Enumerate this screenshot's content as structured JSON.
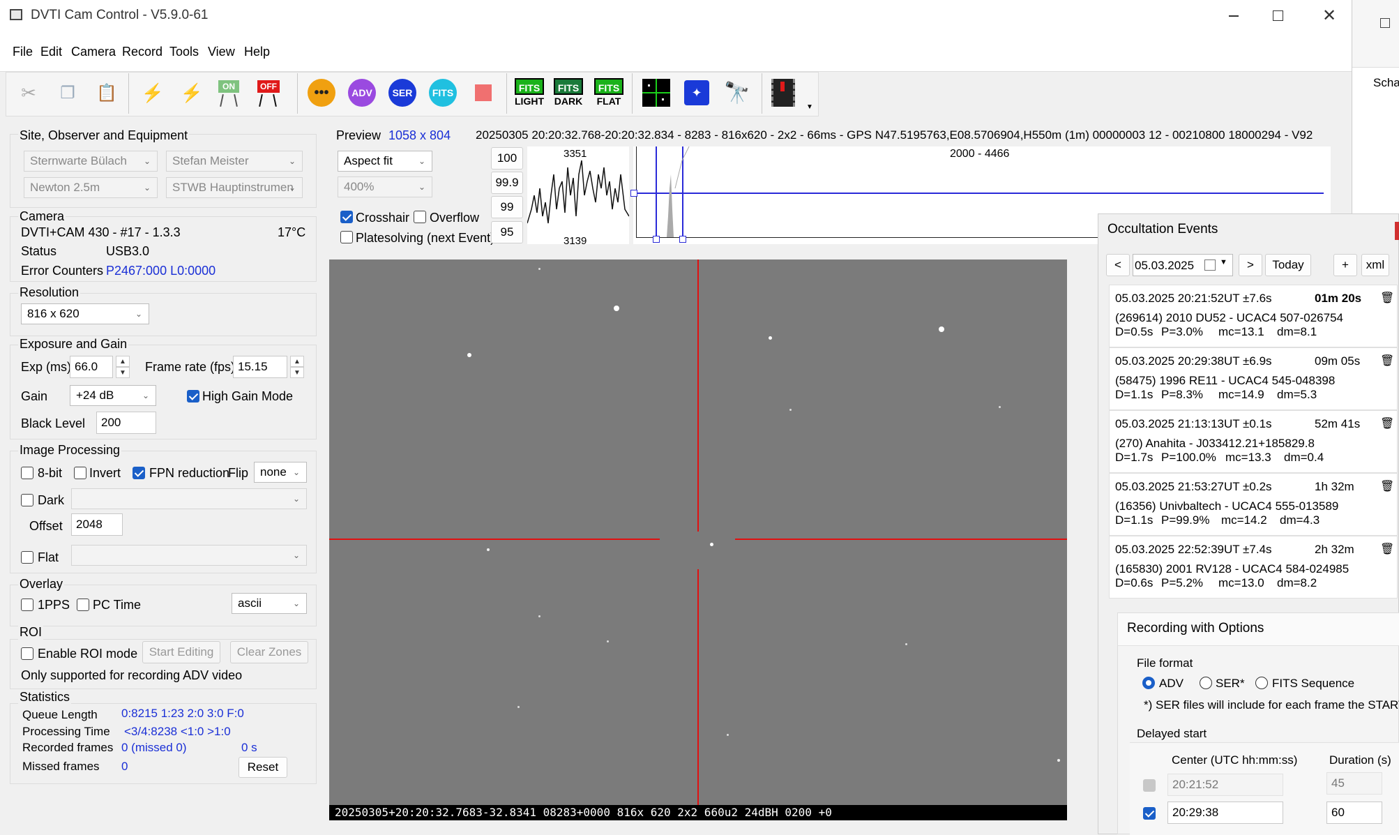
{
  "window": {
    "title": "DVTI Cam Control - V5.9.0-61"
  },
  "menu": [
    "File",
    "Edit",
    "Camera",
    "Record",
    "Tools",
    "View",
    "Help"
  ],
  "toolbar": {
    "adv": "ADV",
    "ser": "SER",
    "fits": "FITS",
    "fits_light": "LIGHT",
    "fits_dark": "DARK",
    "fits_flat": "FLAT",
    "on": "ON",
    "off": "OFF"
  },
  "site": {
    "title": "Site, Observer and Equipment",
    "site": "Sternwarte Bülach",
    "observer": "Stefan Meister",
    "telescope": "Newton 2.5m",
    "instrument": "STWB Hauptinstrumen"
  },
  "camera": {
    "title": "Camera",
    "model": "DVTI+CAM 430  -  #17  -  1.3.3",
    "temp": "17°C",
    "status_label": "Status",
    "status_value": "USB3.0",
    "errors_label": "Error Counters",
    "errors_value": "P2467:000 L0:0000"
  },
  "resolution": {
    "title": "Resolution",
    "value": "816 x 620"
  },
  "exposure": {
    "title": "Exposure and Gain",
    "exp_label": "Exp (ms)",
    "exp_value": "66.0",
    "fps_label": "Frame rate (fps)",
    "fps_value": "15.15",
    "gain_label": "Gain",
    "gain_value": "+24 dB",
    "high_gain_label": "High Gain Mode",
    "high_gain": true,
    "black_label": "Black Level",
    "black_value": "200"
  },
  "processing": {
    "title": "Image Processing",
    "bit8": "8-bit",
    "invert": "Invert",
    "fpn": "FPN reduction",
    "flip_label": "Flip",
    "flip_value": "none",
    "dark": "Dark",
    "offset_label": "Offset",
    "offset_value": "2048",
    "flat": "Flat"
  },
  "overlay": {
    "title": "Overlay",
    "pps": "1PPS",
    "pctime": "PC Time",
    "mode": "ascii"
  },
  "roi": {
    "title": "ROI",
    "enable": "Enable ROI mode",
    "start_editing": "Start Editing",
    "clear_zones": "Clear Zones",
    "note": "Only supported for recording ADV video"
  },
  "stats": {
    "title": "Statistics",
    "queue_label": "Queue Length",
    "queue_value": "0:8215  1:23  2:0  3:0  F:0",
    "proc_label": "Processing Time",
    "proc_value": "<3/4:8238 <1:0  >1:0",
    "rec_label": "Recorded frames",
    "rec_value": "0 (missed 0)",
    "rec_time": "0 s",
    "missed_label": "Missed frames",
    "missed_value": "0",
    "reset": "Reset"
  },
  "preview": {
    "label": "Preview",
    "size": "1058 x 804",
    "info": "20250305 20:20:32.768-20:20:32.834 - 8283 - 816x620 - 2x2 - 66ms - GPS N47.5195763,E08.5706904,H550m (1m) 00000003 12 - 00210800 18000294 - V92",
    "fit": "Aspect fit",
    "zoom": "400%",
    "crosshair": "Crosshair",
    "overflow": "Overflow",
    "platesolving": "Platesolving (next Event)",
    "levels": [
      "100",
      "99.9",
      "99",
      "95"
    ],
    "profile_max": "3351",
    "profile_min": "3139",
    "histogram_range": "2000 - 4466",
    "overlay_text": "20250305+20:20:32.7683-32.8341 08283+0000   816x 620 2x2  660u2 24dBH 0200 +0"
  },
  "events": {
    "title": "Occultation Events",
    "prev": "<",
    "next": ">",
    "date": "05.03.2025",
    "today": "Today",
    "add": "+",
    "xml": "xml",
    "items": [
      {
        "time": "05.03.2025 20:21:52UT ±7.6s",
        "countdown": "01m 20s",
        "object": "(269614) 2010 DU52 - UCAC4 507-026754",
        "d": "D=0.5s",
        "p": "P=3.0%",
        "mc": "mc=13.1",
        "dm": "dm=8.1"
      },
      {
        "time": "05.03.2025 20:29:38UT ±6.9s",
        "countdown": "09m 05s",
        "object": "(58475) 1996 RE11 - UCAC4 545-048398",
        "d": "D=1.1s",
        "p": "P=8.3%",
        "mc": "mc=14.9",
        "dm": "dm=5.3"
      },
      {
        "time": "05.03.2025 21:13:13UT ±0.1s",
        "countdown": "52m 41s",
        "object": "(270) Anahita - J033412.21+185829.8",
        "d": "D=1.7s",
        "p": "P=100.0%",
        "mc": "mc=13.3",
        "dm": "dm=0.4"
      },
      {
        "time": "05.03.2025 21:53:27UT ±0.2s",
        "countdown": "1h 32m",
        "object": "(16356) Univbaltech - UCAC4 555-013589",
        "d": "D=1.1s",
        "p": "P=99.9%",
        "mc": "mc=14.2",
        "dm": "dm=4.3"
      },
      {
        "time": "05.03.2025 22:52:39UT ±7.4s",
        "countdown": "2h 32m",
        "object": "(165830) 2001 RV128 - UCAC4 584-024985",
        "d": "D=0.6s",
        "p": "P=5.2%",
        "mc": "mc=13.0",
        "dm": "dm=8.2"
      }
    ]
  },
  "recording": {
    "title": "Recording with Options",
    "format_label": "File format",
    "adv": "ADV",
    "ser": "SER*",
    "fits": "FITS Sequence",
    "note": "*) SER files will include for each frame the START o",
    "delayed_label": "Delayed start",
    "center_label": "Center (UTC hh:mm:ss)",
    "duration_label": "Duration (s)",
    "row1_time": "20:21:52",
    "row1_dur": "45",
    "row2_time": "20:29:38",
    "row2_dur": "60"
  },
  "background_window": {
    "text": "Scha"
  },
  "colors": {
    "accent": "#1a5fc8",
    "value_blue": "#1a2fd6",
    "crosshair": "#e01010"
  }
}
